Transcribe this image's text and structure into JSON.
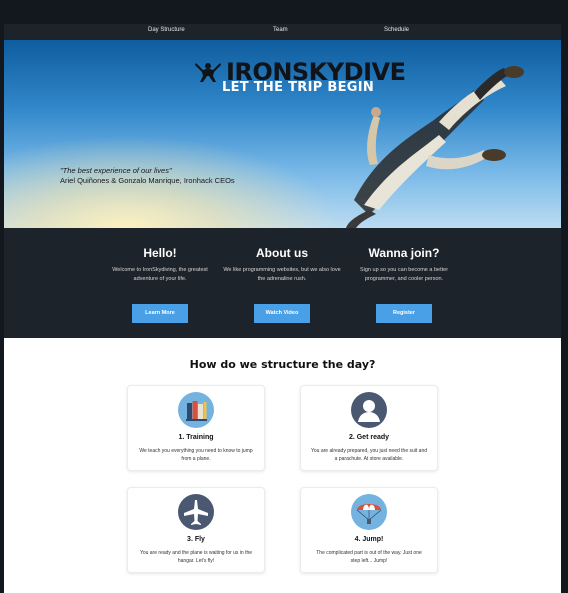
{
  "nav": {
    "items": [
      {
        "label": "Day Structure"
      },
      {
        "label": "Team"
      },
      {
        "label": "Schedule"
      }
    ]
  },
  "hero": {
    "logo_text": "IRONSKYDIVE",
    "tagline": "LET THE TRIP BEGIN",
    "quote": "\"The best experience of our lives\"",
    "quote_author": "Ariel Quiñones & Gonzalo Manrique, Ironhack CEOs"
  },
  "features": [
    {
      "title": "Hello!",
      "text": "Welcome to IronSkydiving, the greatest adventure of your life.",
      "button": "Learn More"
    },
    {
      "title": "About us",
      "text": "We like programming websites, but we also love the adrenaline rush.",
      "button": "Watch Video"
    },
    {
      "title": "Wanna join?",
      "text": "Sign up so you can become a better programmer, and cooler person.",
      "button": "Register"
    }
  ],
  "structure": {
    "title": "How do we structure the day?",
    "cards": [
      {
        "title": "1. Training",
        "text": "We teach you everything you need to know to jump from a plane.",
        "icon": "books-icon"
      },
      {
        "title": "2. Get ready",
        "text": "You are already prepared, you just need the suit and a parachute. At store available.",
        "icon": "person-icon"
      },
      {
        "title": "3. Fly",
        "text": "You are ready and the plane is waiting for us in the hangar. Let's fly!",
        "icon": "airplane-icon"
      },
      {
        "title": "4. Jump!",
        "text": "The complicated part is out of the way. Just one step left... Jump!",
        "icon": "parachute-icon"
      }
    ]
  },
  "colors": {
    "accent": "#4aa0e6",
    "dark_bg": "#1d232a",
    "icon_blue": "#74b3e0",
    "icon_dark": "#4a5872"
  }
}
